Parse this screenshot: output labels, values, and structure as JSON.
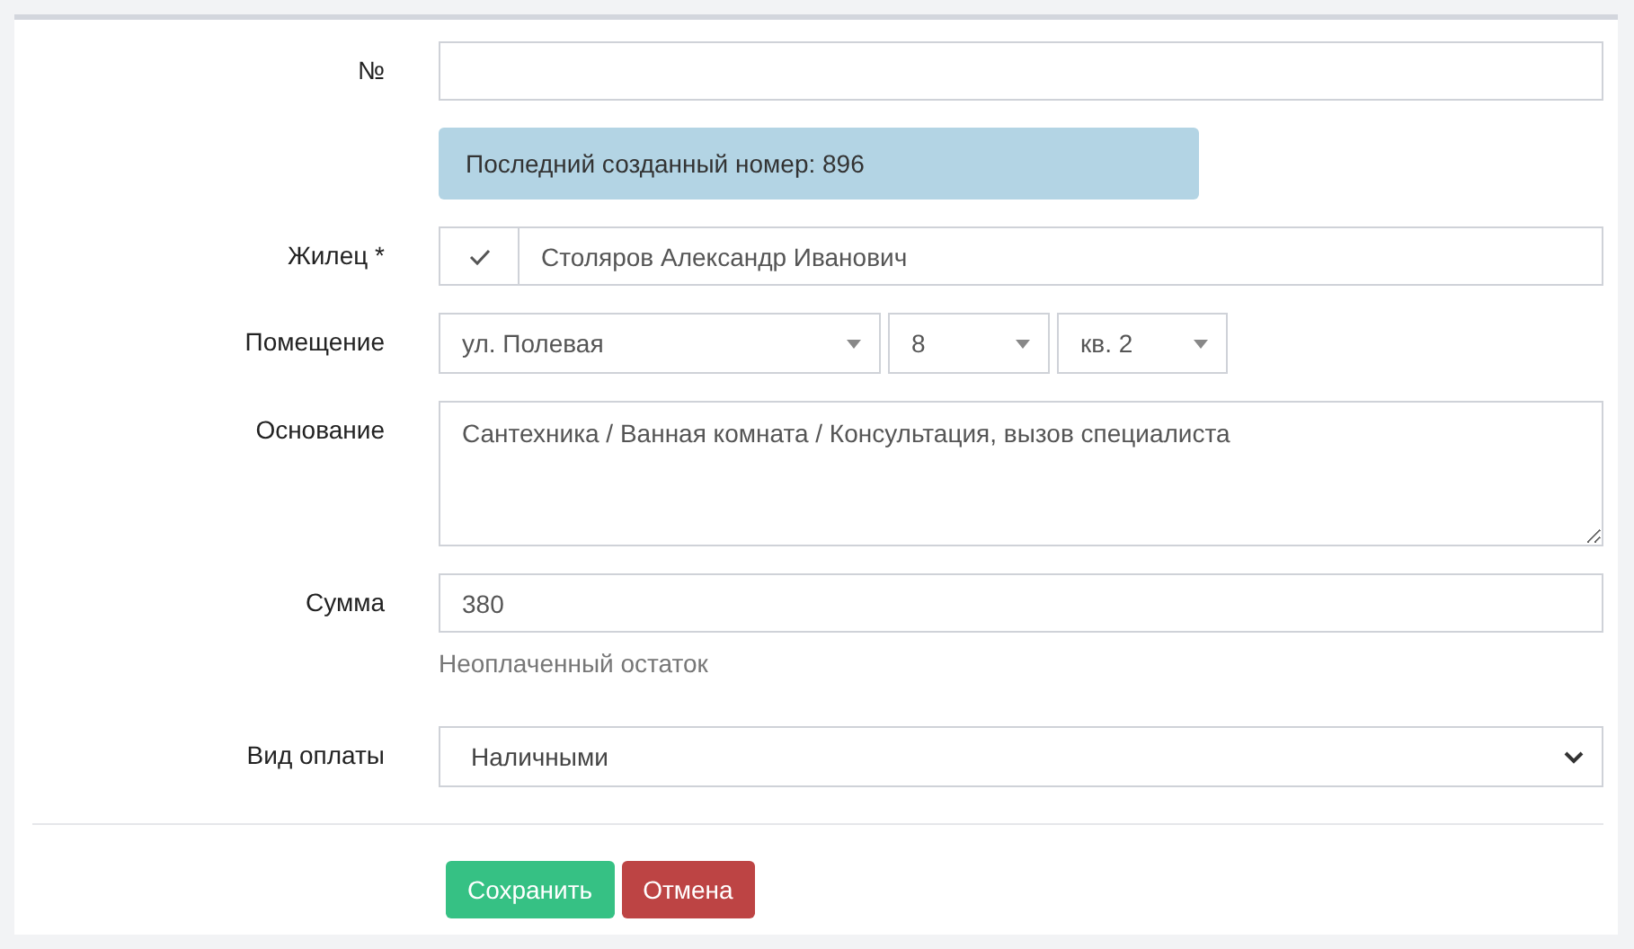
{
  "number_field": {
    "label": "№"
  },
  "notice": "Последний созданный номер: 896",
  "resident": {
    "label": "Жилец *",
    "checked": true,
    "value": "Столяров Александр Иванович"
  },
  "premises": {
    "label": "Помещение",
    "selects": [
      "ул. Полевая",
      "8",
      "кв. 2"
    ]
  },
  "basis": {
    "label": "Основание",
    "value": "Сантехника / Ванная комната / Консультация, вызов специалиста"
  },
  "amount": {
    "label": "Сумма",
    "value": "380",
    "help": "Неоплаченный остаток"
  },
  "payment": {
    "label": "Вид оплаты",
    "value": "Наличными"
  },
  "buttons": [
    {
      "label": "Сохранить",
      "kind": "primary"
    },
    {
      "label": "Отмена",
      "kind": "danger"
    }
  ]
}
